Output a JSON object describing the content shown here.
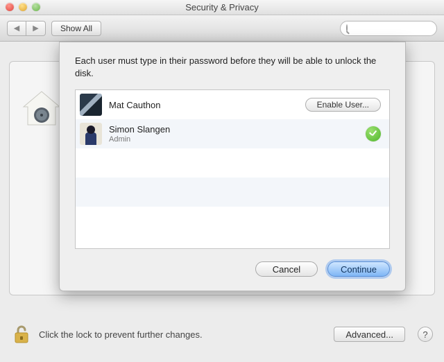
{
  "window": {
    "title": "Security & Privacy"
  },
  "toolbar": {
    "show_all": "Show All",
    "search_placeholder": ""
  },
  "sheet": {
    "message": "Each user must type in their password before they will be able to unlock the disk.",
    "users": [
      {
        "name": "Mat Cauthon",
        "role": "",
        "enabled": false,
        "enable_label": "Enable User..."
      },
      {
        "name": "Simon Slangen",
        "role": "Admin",
        "enabled": true
      }
    ],
    "cancel": "Cancel",
    "continue": "Continue"
  },
  "footer": {
    "lock_text": "Click the lock to prevent further changes.",
    "advanced": "Advanced...",
    "help": "?"
  }
}
